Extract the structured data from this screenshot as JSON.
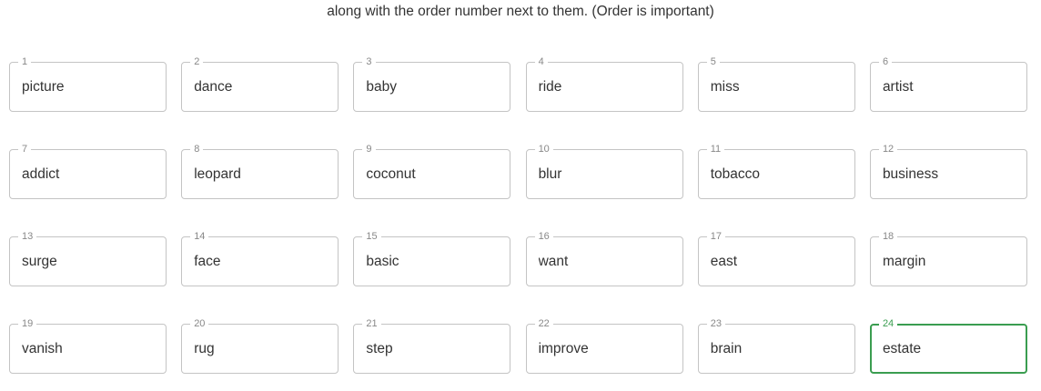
{
  "instruction": "along with the order number next to them. (Order is important)",
  "accent_color": "#3a9d50",
  "active_index": 23,
  "words": [
    {
      "n": "1",
      "word": "picture"
    },
    {
      "n": "2",
      "word": "dance"
    },
    {
      "n": "3",
      "word": "baby"
    },
    {
      "n": "4",
      "word": "ride"
    },
    {
      "n": "5",
      "word": "miss"
    },
    {
      "n": "6",
      "word": "artist"
    },
    {
      "n": "7",
      "word": "addict"
    },
    {
      "n": "8",
      "word": "leopard"
    },
    {
      "n": "9",
      "word": "coconut"
    },
    {
      "n": "10",
      "word": "blur"
    },
    {
      "n": "11",
      "word": "tobacco"
    },
    {
      "n": "12",
      "word": "business"
    },
    {
      "n": "13",
      "word": "surge"
    },
    {
      "n": "14",
      "word": "face"
    },
    {
      "n": "15",
      "word": "basic"
    },
    {
      "n": "16",
      "word": "want"
    },
    {
      "n": "17",
      "word": "east"
    },
    {
      "n": "18",
      "word": "margin"
    },
    {
      "n": "19",
      "word": "vanish"
    },
    {
      "n": "20",
      "word": "rug"
    },
    {
      "n": "21",
      "word": "step"
    },
    {
      "n": "22",
      "word": "improve"
    },
    {
      "n": "23",
      "word": "brain"
    },
    {
      "n": "24",
      "word": "estate"
    }
  ]
}
